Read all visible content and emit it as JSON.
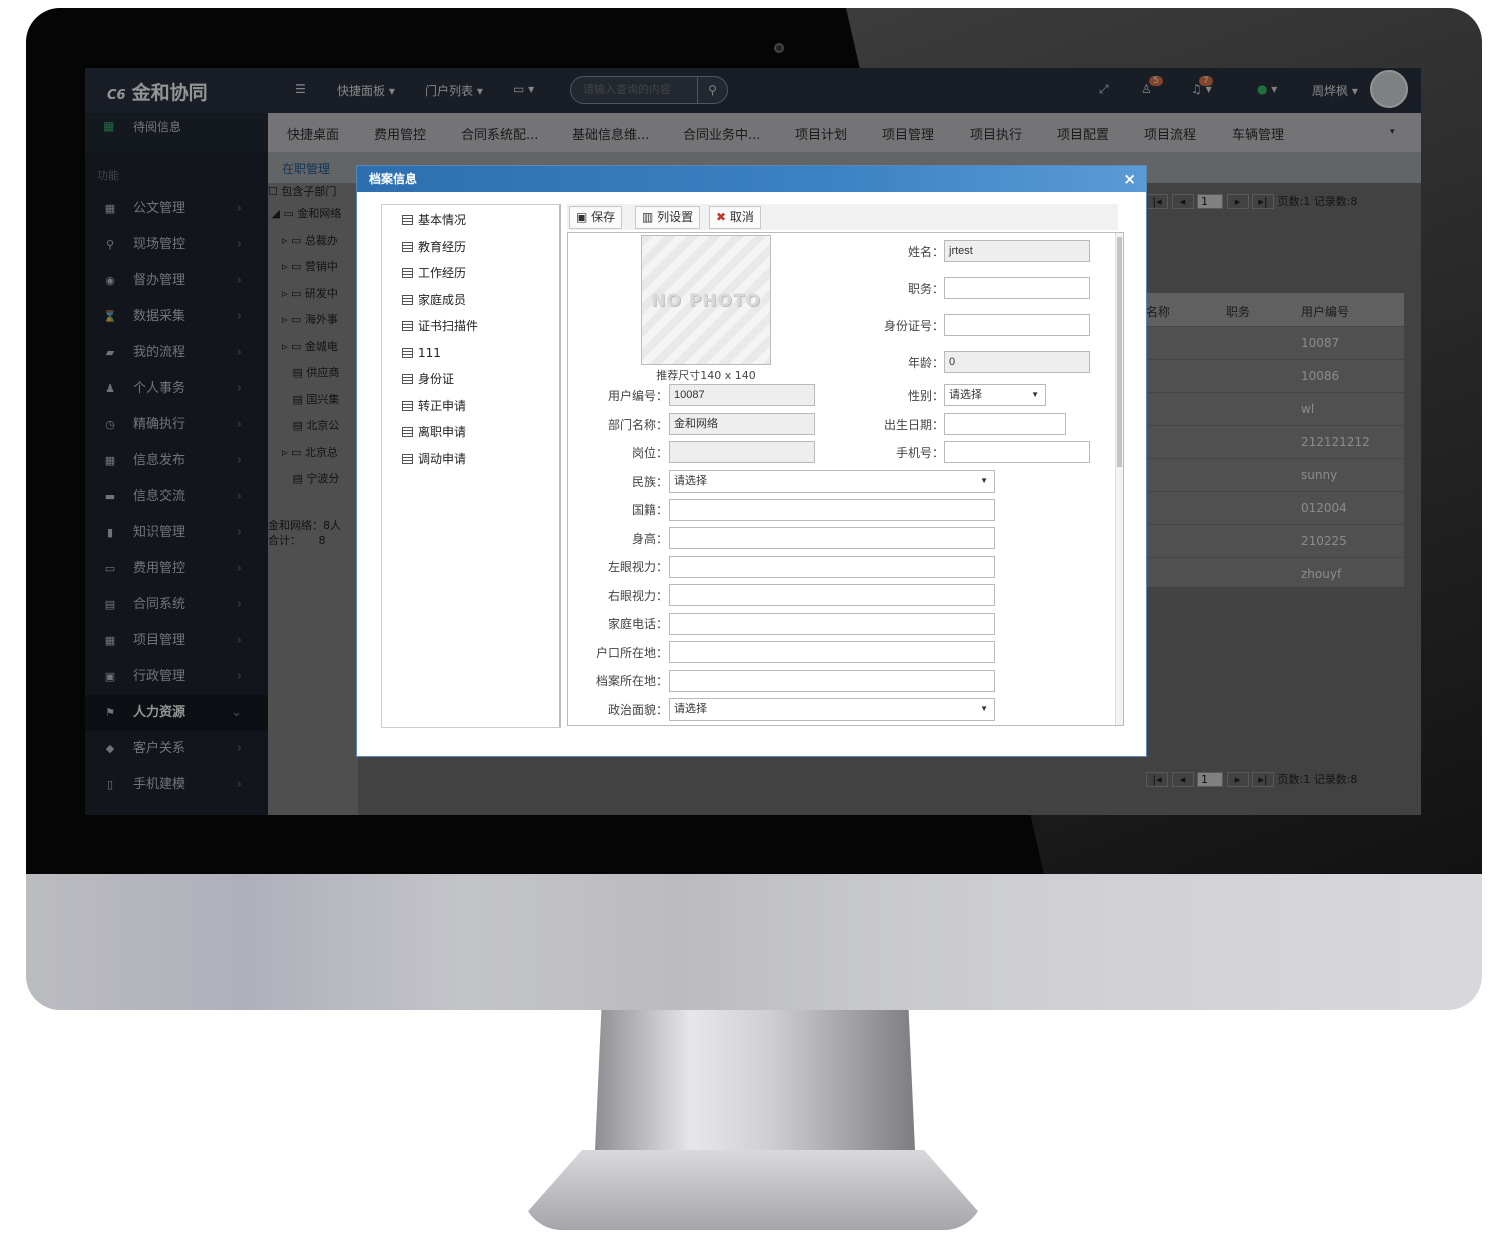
{
  "topbar": {
    "logo_mark": "C6",
    "app_name": "金和协同",
    "menu_icon": "menu-lines-icon",
    "quick_panel": "快捷面板",
    "portal_list": "门户列表",
    "search_placeholder": "请输入查询的内容",
    "notification_badge_1": "5",
    "notification_badge_2": "7",
    "user_name": "周烨枫"
  },
  "sidebar": {
    "pending_label": "待阅信息",
    "section_label": "功能",
    "items": [
      {
        "label": "公文管理",
        "icon": "document-icon"
      },
      {
        "label": "现场管控",
        "icon": "location-icon"
      },
      {
        "label": "督办管理",
        "icon": "eye-icon"
      },
      {
        "label": "数据采集",
        "icon": "hourglass-icon"
      },
      {
        "label": "我的流程",
        "icon": "folder-icon"
      },
      {
        "label": "个人事务",
        "icon": "user-icon"
      },
      {
        "label": "精确执行",
        "icon": "clock-icon"
      },
      {
        "label": "信息发布",
        "icon": "grid-icon"
      },
      {
        "label": "信息交流",
        "icon": "chat-icon"
      },
      {
        "label": "知识管理",
        "icon": "bookmark-icon"
      },
      {
        "label": "费用管控",
        "icon": "card-icon"
      },
      {
        "label": "合同系统",
        "icon": "contract-icon"
      },
      {
        "label": "项目管理",
        "icon": "calendar-icon"
      },
      {
        "label": "行政管理",
        "icon": "briefcase-icon"
      },
      {
        "label": "人力资源",
        "icon": "flag-icon",
        "active": true
      },
      {
        "label": "客户关系",
        "icon": "tags-icon"
      },
      {
        "label": "手机建模",
        "icon": "mobile-icon"
      }
    ]
  },
  "nav_tabs": [
    "快捷桌面",
    "费用管控",
    "合同系统配...",
    "基础信息维...",
    "合同业务中...",
    "项目计划",
    "项目管理",
    "项目执行",
    "项目配置",
    "项目流程",
    "车辆管理"
  ],
  "subnav": {
    "active": "在职管理"
  },
  "tree": {
    "include_sub": "包含子部门",
    "root": "金和网络",
    "nodes": [
      "总裁办",
      "营销中",
      "研发中",
      "海外事",
      "金城电",
      "供应商",
      "国兴集",
      "北京公",
      "北京总",
      "宁波分"
    ],
    "summary_1": "金和网络：8人",
    "summary_2": "合计：",
    "summary_total": "8"
  },
  "grid": {
    "headers": [
      "名称",
      "职务",
      "用户编号"
    ],
    "user_ids": [
      "10087",
      "10086",
      "wl",
      "212121212",
      "sunny",
      "012004",
      "210225",
      "zhouyf"
    ]
  },
  "pager": {
    "page": "1",
    "info": "页数:1 记录数:8"
  },
  "modal": {
    "title": "档案信息",
    "close": "×",
    "left_items": [
      "基本情况",
      "教育经历",
      "工作经历",
      "家庭成员",
      "证书扫描件",
      "111",
      "身份证",
      "转正申请",
      "离职申请",
      "调动申请"
    ],
    "toolbar": {
      "save": "保存",
      "columns": "列设置",
      "cancel": "取消"
    },
    "photo_placeholder": "NO PHOTO",
    "photo_hint": "推荐尺寸140 x 140",
    "fields": {
      "name_label": "姓名：",
      "name_value": "jrtest",
      "position_label": "职务：",
      "position_value": "",
      "id_label": "身份证号：",
      "id_value": "",
      "age_label": "年龄：",
      "age_value": "0",
      "user_no_label": "用户编号：",
      "user_no_value": "10087",
      "gender_label": "性别：",
      "gender_value": "请选择",
      "dept_label": "部门名称：",
      "dept_value": "金和网络",
      "birth_label": "出生日期：",
      "birth_value": "",
      "post_label": "岗位：",
      "post_value": "",
      "mobile_label": "手机号：",
      "mobile_value": "",
      "ethnic_label": "民族：",
      "ethnic_value": "请选择",
      "nationality_label": "国籍：",
      "height_label": "身高：",
      "left_eye_label": "左眼视力：",
      "right_eye_label": "右眼视力：",
      "home_phone_label": "家庭电话：",
      "hukou_label": "户口所在地：",
      "archive_label": "档案所在地：",
      "politics_label": "政治面貌：",
      "politics_value": "请选择"
    }
  }
}
